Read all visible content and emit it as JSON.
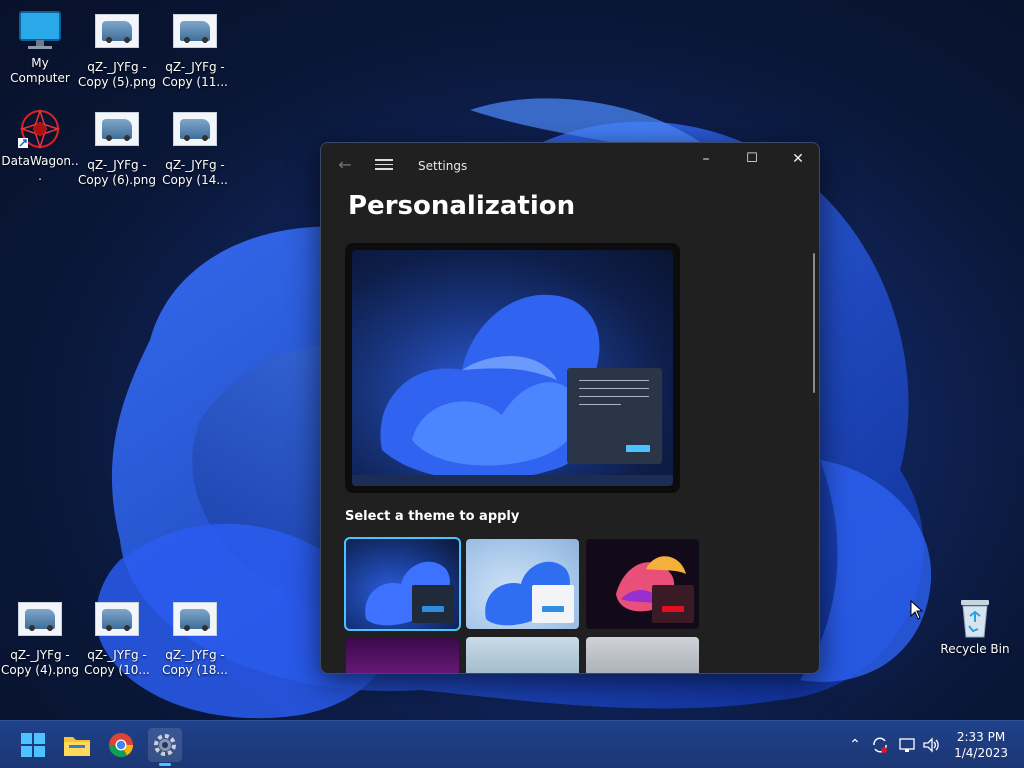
{
  "desktop": {
    "icons": [
      {
        "label": "My Computer"
      },
      {
        "label": "qZ-_JYFg - Copy (5).png"
      },
      {
        "label": "qZ-_JYFg - Copy (11..."
      },
      {
        "label": "DataWagon..."
      },
      {
        "label": "qZ-_JYFg - Copy (6).png"
      },
      {
        "label": "qZ-_JYFg - Copy (14..."
      },
      {
        "label": "qZ-_JYFg - Copy (4).png"
      },
      {
        "label": "qZ-_JYFg - Copy (10..."
      },
      {
        "label": "qZ-_JYFg - Copy (18..."
      }
    ],
    "recycle_bin": {
      "label": "Recycle Bin"
    }
  },
  "settings": {
    "window_title": "Settings",
    "back_icon": "arrow-left-icon",
    "menu_icon": "hamburger-icon",
    "controls": {
      "minimize": "–",
      "maximize": "☐",
      "close": "✕"
    },
    "page_title": "Personalization",
    "theme_section_label": "Select a theme to apply",
    "accent_color": "#4cc2ff",
    "themes": [
      {
        "id": "dark-bloom",
        "selected": true
      },
      {
        "id": "light-bloom",
        "selected": false
      },
      {
        "id": "glow",
        "selected": false
      },
      {
        "id": "captured-motion",
        "selected": false
      },
      {
        "id": "sunrise",
        "selected": false
      },
      {
        "id": "flow",
        "selected": false
      }
    ]
  },
  "taskbar": {
    "apps": [
      "windows-start-icon",
      "file-explorer-icon",
      "chrome-icon",
      "settings-icon"
    ],
    "active_app": "settings-icon",
    "tray": [
      "chevron-up-icon",
      "sync-icon",
      "network-icon",
      "volume-icon"
    ],
    "time": "2:33 PM",
    "date": "1/4/2023"
  }
}
